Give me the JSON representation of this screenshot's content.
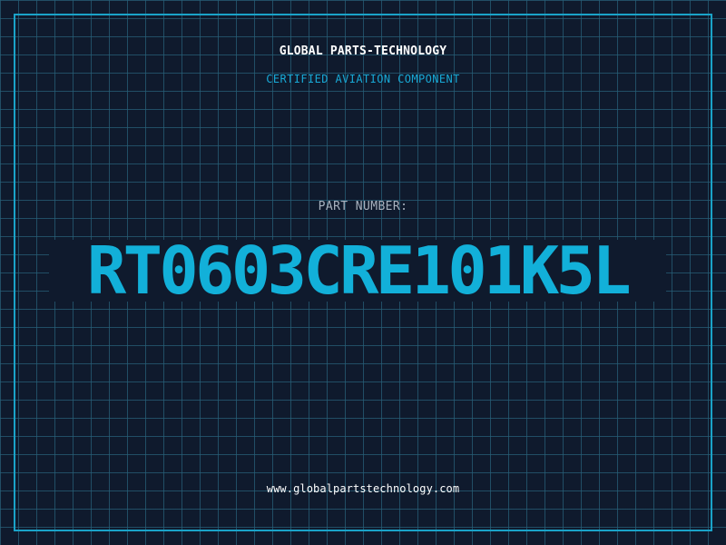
{
  "header": {
    "company_name": "GLOBAL PARTS-TECHNOLOGY",
    "subtitle": "CERTIFIED AVIATION COMPONENT"
  },
  "part": {
    "label": "PART NUMBER:",
    "number": "RT0603CRE101K5L"
  },
  "footer": {
    "website": "www.globalpartstechnology.com"
  },
  "colors": {
    "background": "#0f1a2d",
    "grid": "#275e78",
    "accent": "#12b0d9",
    "frame": "#1aa3c8",
    "label_text": "#a8b2bf",
    "white_text": "#ffffff"
  }
}
